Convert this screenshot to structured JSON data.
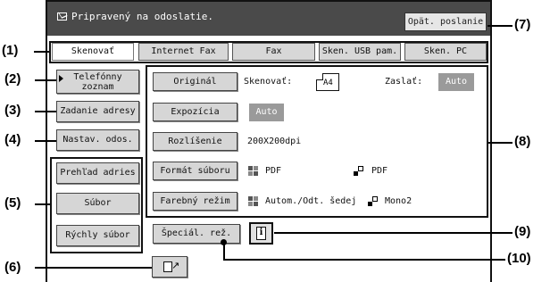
{
  "status": {
    "message": "Pripravený na odoslatie.",
    "resend_label": "Opät. poslanie"
  },
  "tabs": [
    {
      "label": "Skenovať",
      "active": true
    },
    {
      "label": "Internet Fax",
      "active": false
    },
    {
      "label": "Fax",
      "active": false
    },
    {
      "label": "Sken. USB pam.",
      "active": false
    },
    {
      "label": "Sken. PC",
      "active": false
    }
  ],
  "left_buttons": {
    "address_book": "Telefónny\nzoznam",
    "address_entry": "Zadanie adresy",
    "sender_settings": "Nastav. odos.",
    "address_review": "Prehľad adries",
    "file": "Súbor",
    "quick_file": "Rýchly súbor"
  },
  "settings": {
    "original": {
      "label": "Originál",
      "scan_label": "Skenovať:",
      "scan_size": "A4",
      "send_label": "Zaslať:",
      "send_value": "Auto"
    },
    "exposure": {
      "label": "Expozícia",
      "value": "Auto"
    },
    "resolution": {
      "label": "Rozlíšenie",
      "value": "200X200dpi"
    },
    "file_format": {
      "label": "Formát súboru",
      "color_format": "PDF",
      "mono_format": "PDF"
    },
    "color_mode": {
      "label": "Farebný režim",
      "color_value": "Autom./Odt. šedej",
      "mono_value": "Mono2"
    }
  },
  "bottom": {
    "special_modes": "Špeciál. rež.",
    "info_glyph": "i"
  },
  "callouts": [
    "(1)",
    "(2)",
    "(3)",
    "(4)",
    "(5)",
    "(6)",
    "(7)",
    "(8)",
    "(9)",
    "(10)"
  ],
  "colors": {
    "status_bar": "#4a4a4a",
    "button": "#d6d6d6",
    "auto_badge": "#9a9a9a"
  }
}
